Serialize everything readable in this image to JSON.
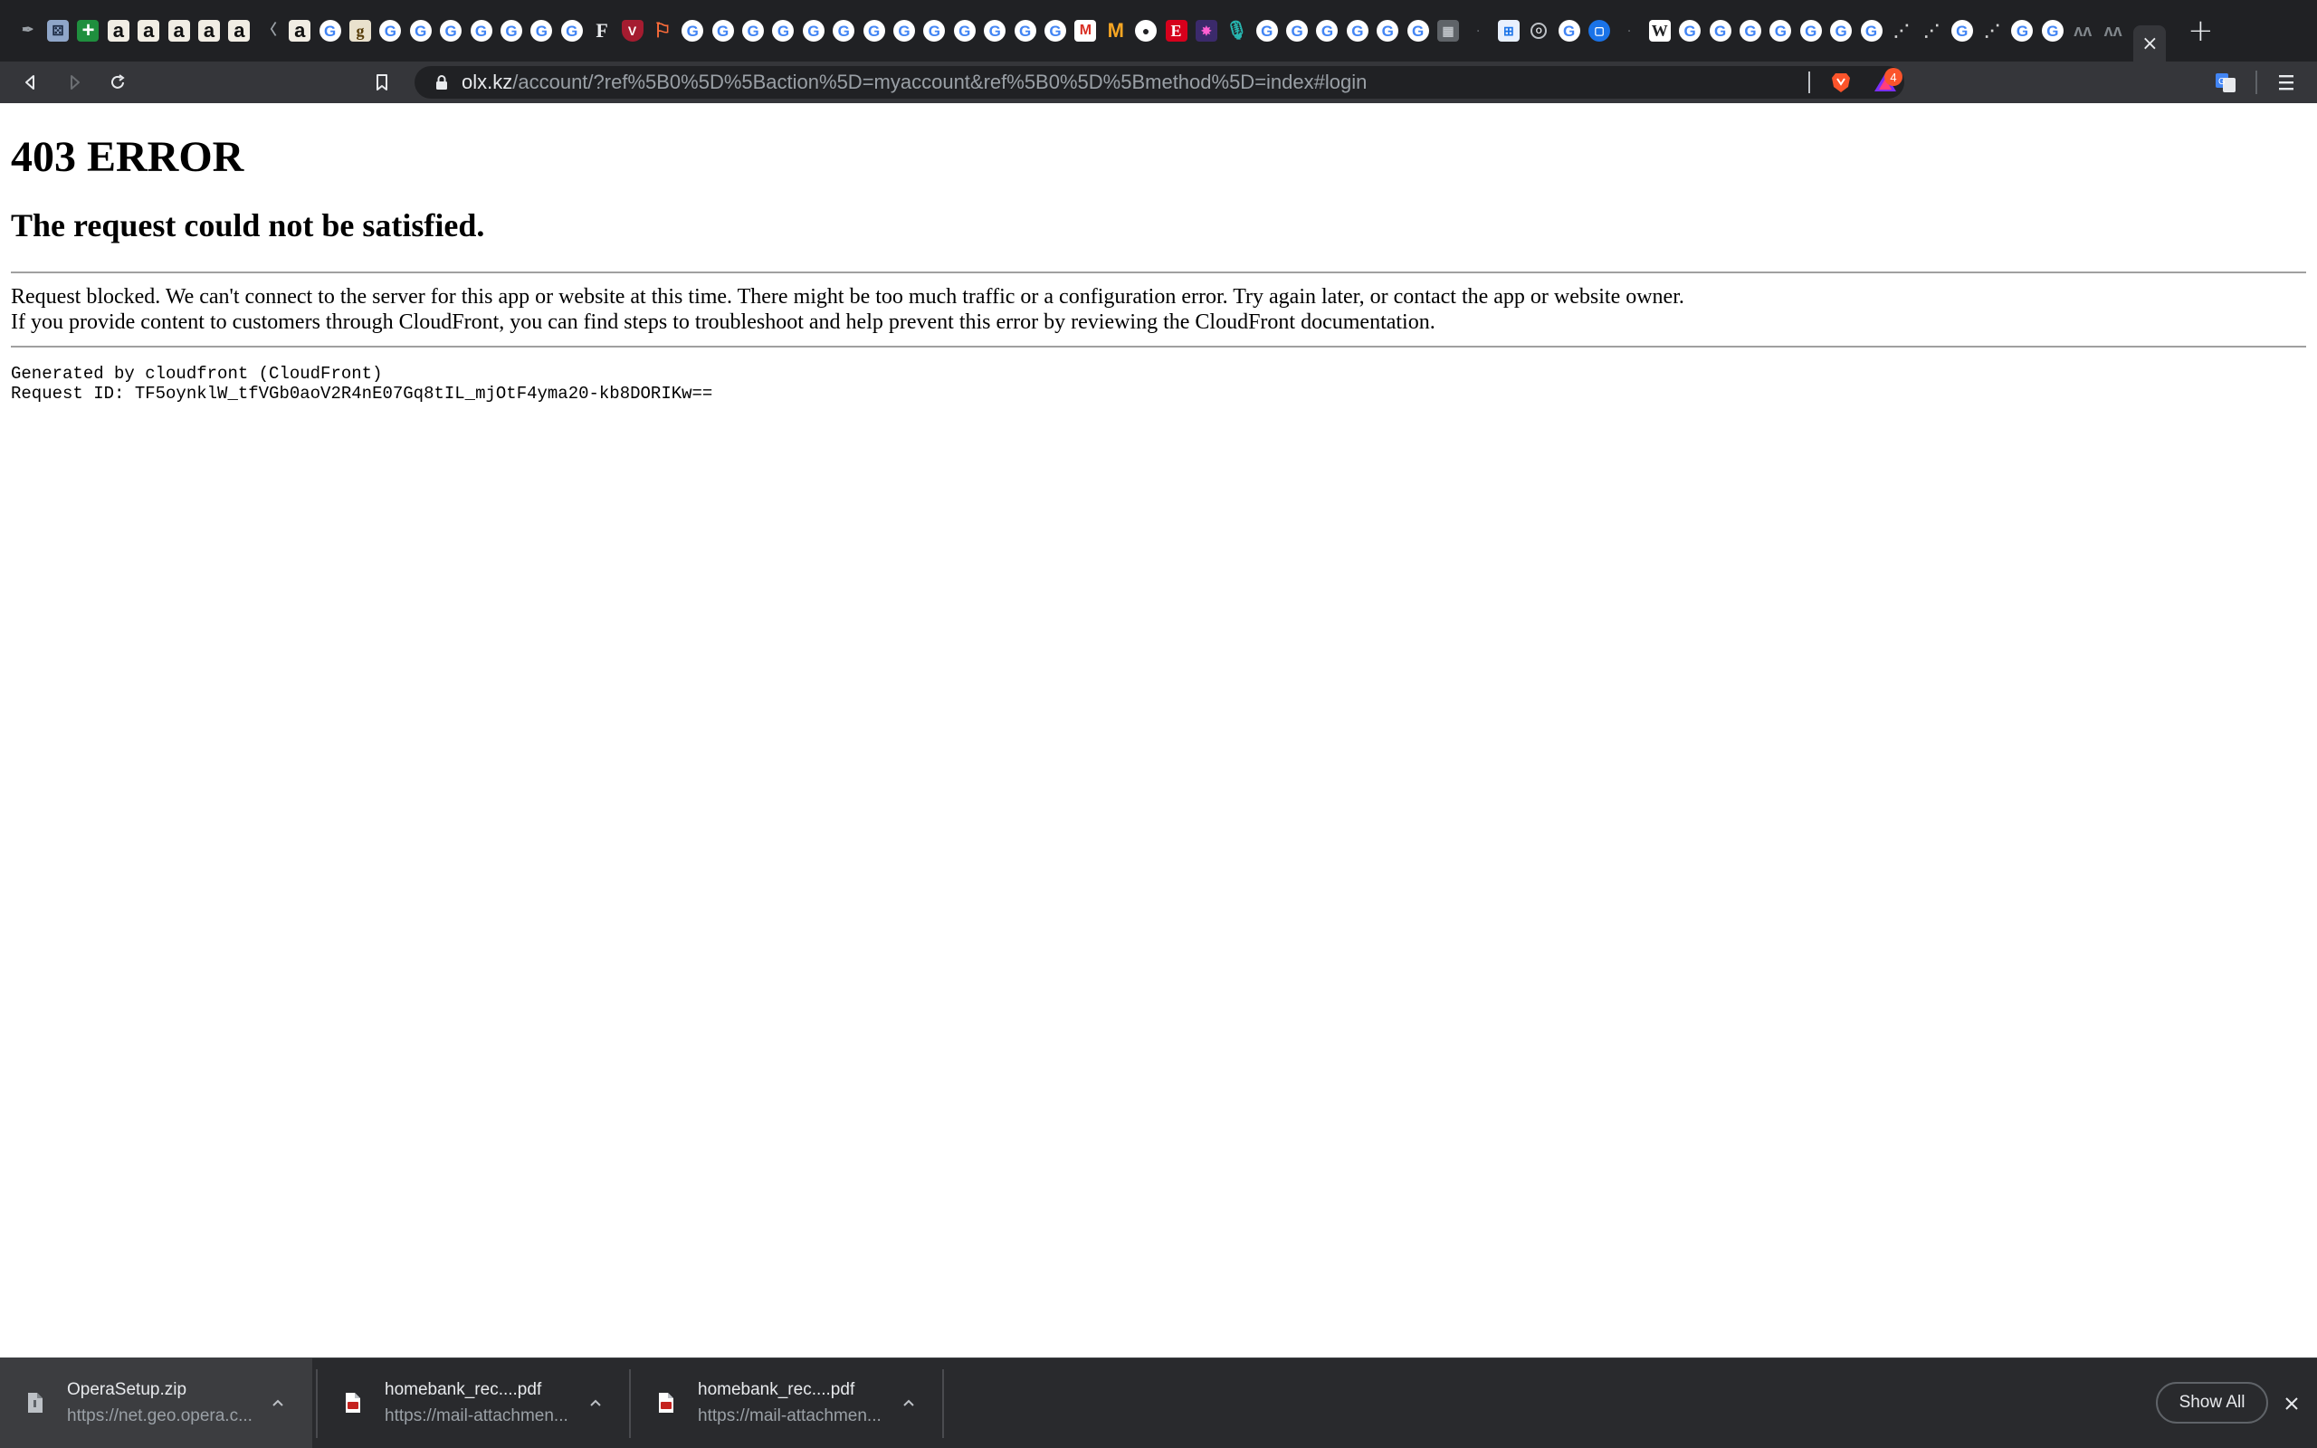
{
  "browser": {
    "tabs": [
      {
        "icon": "dark-icon",
        "glyph": "✒"
      },
      {
        "icon": "game-icon",
        "glyph": "⚄"
      },
      {
        "icon": "plus-icon",
        "glyph": "+"
      },
      {
        "icon": "amazon-icon",
        "glyph": "a"
      },
      {
        "icon": "amazon-icon",
        "glyph": "a"
      },
      {
        "icon": "amazon-icon",
        "glyph": "a"
      },
      {
        "icon": "amazon-icon",
        "glyph": "a"
      },
      {
        "icon": "amazon-icon",
        "glyph": "a"
      },
      {
        "icon": "dark-icon",
        "glyph": "〈"
      },
      {
        "icon": "amazon-icon",
        "glyph": "a"
      },
      {
        "icon": "google-icon",
        "glyph": "G"
      },
      {
        "icon": "goodreads-icon",
        "glyph": "g"
      },
      {
        "icon": "google-icon",
        "glyph": "G"
      },
      {
        "icon": "google-icon",
        "glyph": "G"
      },
      {
        "icon": "google-icon",
        "glyph": "G"
      },
      {
        "icon": "google-icon",
        "glyph": "G"
      },
      {
        "icon": "google-icon",
        "glyph": "G"
      },
      {
        "icon": "google-icon",
        "glyph": "G"
      },
      {
        "icon": "google-icon",
        "glyph": "G"
      },
      {
        "icon": "forbes-icon",
        "glyph": "F"
      },
      {
        "icon": "harvard-icon",
        "glyph": "V"
      },
      {
        "icon": "drink-icon",
        "glyph": "⚐"
      },
      {
        "icon": "google-icon",
        "glyph": "G"
      },
      {
        "icon": "google-icon",
        "glyph": "G"
      },
      {
        "icon": "google-icon",
        "glyph": "G"
      },
      {
        "icon": "google-icon",
        "glyph": "G"
      },
      {
        "icon": "google-icon",
        "glyph": "G"
      },
      {
        "icon": "google-icon",
        "glyph": "G"
      },
      {
        "icon": "google-icon",
        "glyph": "G"
      },
      {
        "icon": "google-icon",
        "glyph": "G"
      },
      {
        "icon": "google-icon",
        "glyph": "G"
      },
      {
        "icon": "google-icon",
        "glyph": "G"
      },
      {
        "icon": "google-icon",
        "glyph": "G"
      },
      {
        "icon": "google-icon",
        "glyph": "G"
      },
      {
        "icon": "google-icon",
        "glyph": "G"
      },
      {
        "icon": "gmail-icon",
        "glyph": "M"
      },
      {
        "icon": "medium-icon",
        "glyph": "M"
      },
      {
        "icon": "github-icon",
        "glyph": "●"
      },
      {
        "icon": "e-icon",
        "glyph": "E"
      },
      {
        "icon": "star-icon",
        "glyph": "✸"
      },
      {
        "icon": "mic-icon",
        "glyph": "🎙"
      },
      {
        "icon": "google-icon",
        "glyph": "G"
      },
      {
        "icon": "google-icon",
        "glyph": "G"
      },
      {
        "icon": "google-icon",
        "glyph": "G"
      },
      {
        "icon": "google-icon",
        "glyph": "G"
      },
      {
        "icon": "google-icon",
        "glyph": "G"
      },
      {
        "icon": "google-icon",
        "glyph": "G"
      },
      {
        "icon": "box-icon",
        "glyph": "▦"
      },
      {
        "icon": "dim-icon",
        "glyph": "·"
      },
      {
        "icon": "grid-icon",
        "glyph": "⊞"
      },
      {
        "icon": "ring-icon",
        "glyph": "O"
      },
      {
        "icon": "google-icon",
        "glyph": "G"
      },
      {
        "icon": "chat-icon",
        "glyph": "▢"
      },
      {
        "icon": "dim-icon",
        "glyph": "·"
      },
      {
        "icon": "wiki-icon",
        "glyph": "W"
      },
      {
        "icon": "google-icon",
        "glyph": "G"
      },
      {
        "icon": "google-icon",
        "glyph": "G"
      },
      {
        "icon": "google-icon",
        "glyph": "G"
      },
      {
        "icon": "google-icon",
        "glyph": "G"
      },
      {
        "icon": "google-icon",
        "glyph": "G"
      },
      {
        "icon": "google-icon",
        "glyph": "G"
      },
      {
        "icon": "google-icon",
        "glyph": "G"
      },
      {
        "icon": "stripes-icon",
        "glyph": "⋰"
      },
      {
        "icon": "stripes-icon",
        "glyph": "⋰"
      },
      {
        "icon": "google-icon",
        "glyph": "G"
      },
      {
        "icon": "stripes-icon",
        "glyph": "⋰"
      },
      {
        "icon": "google-icon",
        "glyph": "G"
      },
      {
        "icon": "google-icon",
        "glyph": "G"
      },
      {
        "icon": "wave-icon",
        "glyph": "ʌʌ"
      },
      {
        "icon": "wave-icon",
        "glyph": "ʌʌ"
      }
    ],
    "active_tab_close": "×",
    "new_tab": "+",
    "address": {
      "domain": "olx.kz",
      "path": "/account/?ref%5B0%5D%5Baction%5D=myaccount&ref%5B0%5D%5Bmethod%5D=index#login"
    },
    "rewards_badge": "4"
  },
  "page": {
    "title": "403 ERROR",
    "subtitle": "The request could not be satisfied.",
    "paragraph_lines": [
      "Request blocked. We can't connect to the server for this app or website at this time. There might be too much traffic or a configuration error. Try again later, or contact the app or website owner.",
      "If you provide content to customers through CloudFront, you can find steps to troubleshoot and help prevent this error by reviewing the CloudFront documentation."
    ],
    "generated_by": "Generated by cloudfront (CloudFront)",
    "request_id": "Request ID: TF5oynklW_tfVGb0aoV2R4nE07Gq8tIL_mjOtF4yma20-kb8DORIKw=="
  },
  "downloads": {
    "items": [
      {
        "name": "OperaSetup.zip",
        "url": "https://net.geo.opera.c...",
        "type": "zip"
      },
      {
        "name": "homebank_rec....pdf",
        "url": "https://mail-attachmen...",
        "type": "pdf"
      },
      {
        "name": "homebank_rec....pdf",
        "url": "https://mail-attachmen...",
        "type": "pdf"
      }
    ],
    "show_all": "Show All"
  }
}
